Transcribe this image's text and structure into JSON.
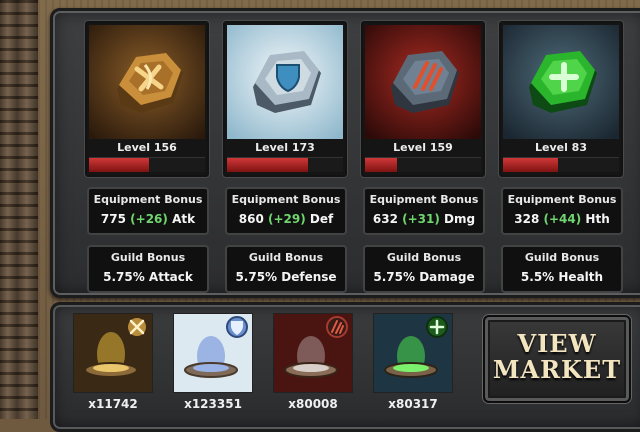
{
  "cards": [
    {
      "level": "Level 156",
      "level_fill": 0.52,
      "eq_title": "Equipment Bonus",
      "eq_base": "775",
      "eq_bonus": "(+26)",
      "eq_stat": "Atk",
      "guild_title": "Guild Bonus",
      "guild_value": "5.75% Attack",
      "theme": "gold",
      "icon": "sword-axe-rune-icon"
    },
    {
      "level": "Level 173",
      "level_fill": 0.7,
      "eq_title": "Equipment Bonus",
      "eq_base": "860",
      "eq_bonus": "(+29)",
      "eq_stat": "Def",
      "guild_title": "Guild Bonus",
      "guild_value": "5.75% Defense",
      "theme": "blue",
      "icon": "shield-rune-icon"
    },
    {
      "level": "Level 159",
      "level_fill": 0.28,
      "eq_title": "Equipment Bonus",
      "eq_base": "632",
      "eq_bonus": "(+31)",
      "eq_stat": "Dmg",
      "guild_title": "Guild Bonus",
      "guild_value": "5.75% Damage",
      "theme": "red",
      "icon": "claw-rune-icon"
    },
    {
      "level": "Level 83",
      "level_fill": 0.47,
      "eq_title": "Equipment Bonus",
      "eq_base": "328",
      "eq_bonus": "(+44)",
      "eq_stat": "Hth",
      "guild_title": "Guild Bonus",
      "guild_value": "5.5% Health",
      "theme": "green",
      "icon": "cross-rune-icon"
    }
  ],
  "items": [
    {
      "count": "x11742",
      "theme": "gold",
      "icon": "crossed-swords-icon"
    },
    {
      "count": "x123351",
      "theme": "blue",
      "icon": "shield-icon"
    },
    {
      "count": "x80008",
      "theme": "red",
      "icon": "claw-icon"
    },
    {
      "count": "x80317",
      "theme": "green",
      "icon": "plus-icon"
    }
  ],
  "view_market": {
    "line1": "VIEW",
    "line2": "MARKET"
  },
  "colors": {
    "bonus_green": "#6fd66f",
    "level_bar": "#d13838"
  }
}
